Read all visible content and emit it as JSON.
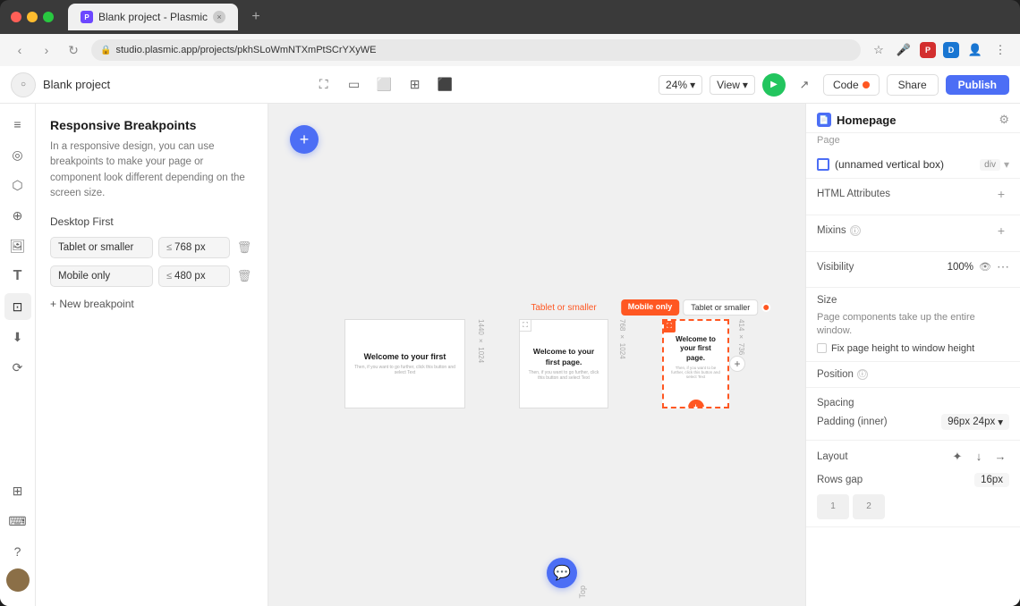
{
  "browser": {
    "tab_label": "Blank project - Plasmic",
    "tab_close": "×",
    "tab_new": "+",
    "address": "studio.plasmic.app/projects/pkhSLoWmNTXmPtSCrYXyWE"
  },
  "app_header": {
    "project_name": "Blank project",
    "zoom": "24%",
    "view_label": "View",
    "code_label": "Code",
    "share_label": "Share",
    "publish_label": "Publish"
  },
  "breakpoints_panel": {
    "title": "Responsive Breakpoints",
    "description": "In a responsive design, you can use breakpoints to make your page or component look different depending on the screen size.",
    "desktop_first_label": "Desktop First",
    "breakpoints": [
      {
        "name": "Tablet or smaller",
        "operator": "≤",
        "value": "768 px"
      },
      {
        "name": "Mobile only",
        "operator": "≤",
        "value": "480 px"
      }
    ],
    "new_breakpoint_btn": "+ New breakpoint"
  },
  "canvas": {
    "add_btn": "+",
    "frames": [
      {
        "label_top": "1440 × 1024",
        "text": "Welcome to your first",
        "subtext": "Then, if you want to go further, click this button and select Text"
      },
      {
        "label": "Tablet or smaller",
        "label_top": "768 × 1024",
        "text": "Welcome to your first page.",
        "subtext": "Then, if you want to go further, click this button and select Text"
      },
      {
        "label": "Mobile only",
        "label_alt": "Tablet or smaller",
        "label_top": "414 × 736",
        "text": "Welcome to your first page.",
        "subtext": "Then, if you want to be further, click this button and select Text"
      }
    ]
  },
  "right_panel": {
    "page_icon": "📄",
    "title": "Homepage",
    "subtitle": "Page",
    "gear_icon": "⚙",
    "component": {
      "name": "(unnamed vertical box)",
      "type": "div"
    },
    "html_attributes": {
      "label": "HTML Attributes",
      "add_icon": "+"
    },
    "mixins": {
      "label": "Mixins",
      "info_icon": "ⓘ",
      "add_icon": "+"
    },
    "visibility": {
      "label": "Visibility",
      "value": "100%",
      "eye_icon": "👁",
      "more_icon": "⋯"
    },
    "size": {
      "label": "Size",
      "info_text": "Page components take up the entire window.",
      "fix_page_label": "Fix page height to window height"
    },
    "position": {
      "label": "Position",
      "info_icon": "ⓘ"
    },
    "spacing": {
      "label": "Spacing",
      "padding_label": "Padding (inner)",
      "padding_value": "96px 24px"
    },
    "layout": {
      "label": "Layout",
      "rows_gap_label": "Rows gap",
      "rows_gap_value": "16px",
      "grid": [
        "1",
        "2"
      ]
    }
  }
}
